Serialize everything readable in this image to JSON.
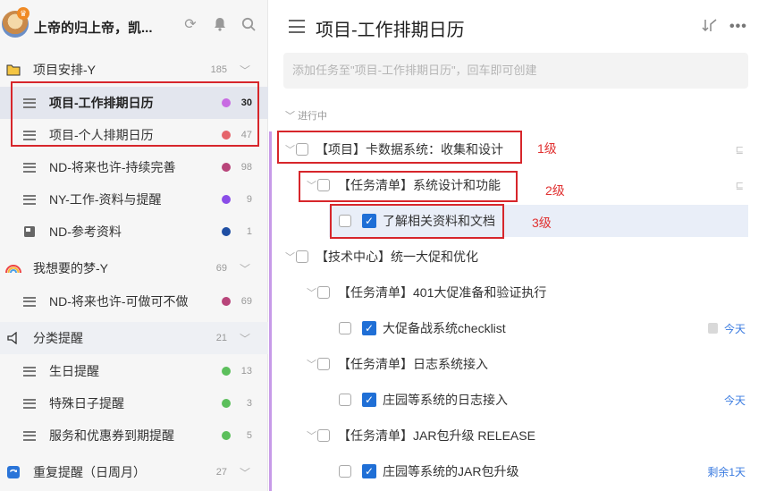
{
  "sidebar": {
    "username": "上帝的归上帝，凯...",
    "header_icons": [
      "refresh-icon",
      "bell-icon",
      "search-icon"
    ],
    "groups": [
      {
        "label": "项目安排-Y",
        "count": "185",
        "icon": "folder-icon"
      },
      {
        "label": "我想要的梦-Y",
        "count": "69",
        "icon": "rainbow-icon"
      },
      {
        "label": "分类提醒",
        "count": "21",
        "icon": "reminder-icon"
      },
      {
        "label": "重复提醒（日周月）",
        "count": "27",
        "icon": "repeat-icon"
      }
    ],
    "lists": [
      {
        "label": "项目-工作排期日历",
        "count": "30",
        "dot": "#c86be2"
      },
      {
        "label": "项目-个人排期日历",
        "count": "47",
        "dot": "#e5646b"
      },
      {
        "label": "ND-将来也许-持续完善",
        "count": "98",
        "dot": "#b8457a"
      },
      {
        "label": "NY-工作-资料与提醒",
        "count": "9",
        "dot": "#8a4de8"
      },
      {
        "label": "ND-参考资料",
        "count": "1",
        "dot": "#1f4ea3"
      },
      {
        "label": "ND-将来也许-可做可不做",
        "count": "69",
        "dot": "#b8457a"
      },
      {
        "label": "生日提醒",
        "count": "13",
        "dot": "#5cbf5c"
      },
      {
        "label": "特殊日子提醒",
        "count": "3",
        "dot": "#5cbf5c"
      },
      {
        "label": "服务和优惠券到期提醒",
        "count": "5",
        "dot": "#5cbf5c"
      }
    ]
  },
  "main": {
    "title": "项目-工作排期日历",
    "add_placeholder": "添加任务至\"项目-工作排期日历\"，回车即可创建",
    "section": "进行中",
    "tasks": [
      {
        "text": "【项目】卡数据系统：收集和设计"
      },
      {
        "text": "【任务清单】系统设计和功能"
      },
      {
        "text": "了解相关资料和文档"
      },
      {
        "text": "【技术中心】统一大促和优化"
      },
      {
        "text": "【任务清单】401大促准备和验证执行"
      },
      {
        "text": "大促备战系统checklist",
        "due": "今天"
      },
      {
        "text": "【任务清单】日志系统接入"
      },
      {
        "text": "庄园等系统的日志接入",
        "due": "今天"
      },
      {
        "text": "【任务清单】JAR包升级 RELEASE"
      },
      {
        "text": "庄园等系统的JAR包升级",
        "due": "剩余1天"
      }
    ]
  },
  "annotations": {
    "level1": "1级",
    "level2": "2级",
    "level3": "3级"
  },
  "colors": {
    "accent": "#1f6fd6",
    "highlight": "#d7262b",
    "selected_bg": "#e3e6ee"
  }
}
